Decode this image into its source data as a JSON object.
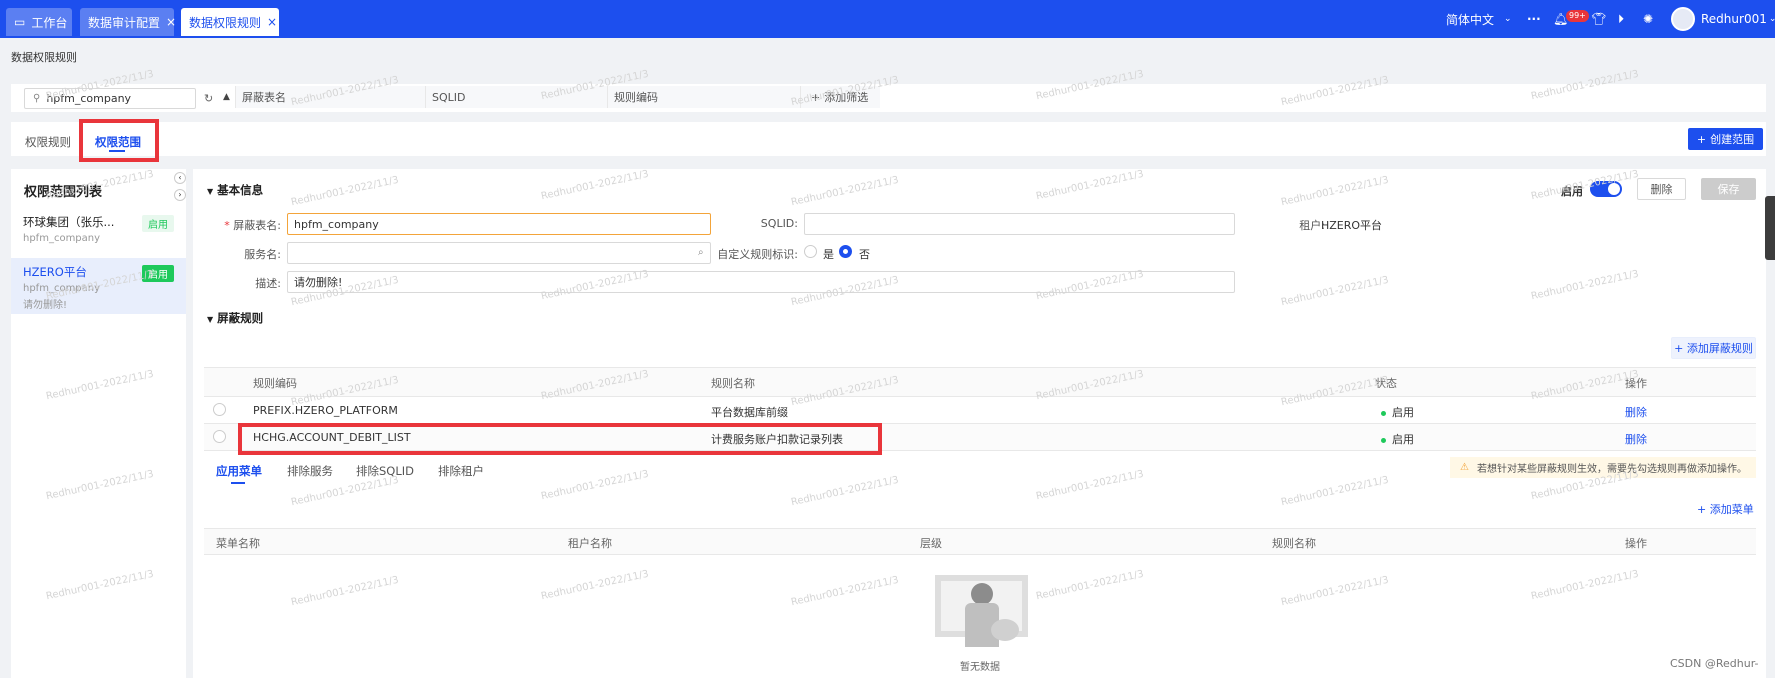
{
  "topbar": {
    "tabs": [
      {
        "label": "工作台"
      },
      {
        "label": "数据审计配置"
      },
      {
        "label": "数据权限规则"
      }
    ],
    "language": "简体中文",
    "more": "···",
    "notification_count": "99+",
    "username": "Redhur001"
  },
  "page": {
    "title": "数据权限规则"
  },
  "search": {
    "value": "hpfm_company",
    "filters": [
      "屏蔽表名",
      "SQLID",
      "规则编码"
    ],
    "add_filter": "添加筛选"
  },
  "main_tabs": [
    "权限规则",
    "权限范围"
  ],
  "create_button": "创建范围",
  "left_panel": {
    "title": "权限范围列表",
    "items": [
      {
        "title": "环球集团（张乐...",
        "sub": "hpfm_company",
        "desc": "",
        "status": "启用"
      },
      {
        "title": "HZERO平台",
        "sub": "hpfm_company",
        "desc": "请勿删除!",
        "status": "启用"
      }
    ]
  },
  "basic_info": {
    "section_title": "基本信息",
    "enable_label": "启用",
    "delete_button": "删除",
    "save_button": "保存",
    "table_name_label": "屏蔽表名",
    "table_name_value": "hpfm_company",
    "sqlid_label": "SQLID",
    "sqlid_value": "",
    "tenant_label": "租户",
    "tenant_value": "HZERO平台",
    "service_label": "服务名",
    "service_value": "",
    "custom_rule_label": "自定义规则标识",
    "radio_yes": "是",
    "radio_no": "否",
    "desc_label": "描述",
    "desc_value": "请勿删除!"
  },
  "rules": {
    "section_title": "屏蔽规则",
    "add_button": "添加屏蔽规则",
    "columns": [
      "规则编码",
      "规则名称",
      "状态",
      "操作"
    ],
    "rows": [
      {
        "code": "PREFIX.HZERO_PLATFORM",
        "name": "平台数据库前缀",
        "status": "启用",
        "action": "删除"
      },
      {
        "code": "HCHG.ACCOUNT_DEBIT_LIST",
        "name": "计费服务账户扣款记录列表",
        "status": "启用",
        "action": "删除"
      }
    ]
  },
  "sub_tabs": [
    "应用菜单",
    "排除服务",
    "排除SQLID",
    "排除租户"
  ],
  "warning": "若想针对某些屏蔽规则生效，需要先勾选规则再做添加操作。",
  "menu_table": {
    "add_button": "添加菜单",
    "columns": [
      "菜单名称",
      "租户名称",
      "层级",
      "规则名称",
      "操作"
    ],
    "empty_text": "暂无数据"
  },
  "watermark": "Redhur001-2022/11/3",
  "footer_mark": "CSDN @Redhur-",
  "colors": {
    "primary": "#1d4fee",
    "highlight": "#e9353b",
    "success": "#1ec95b"
  }
}
